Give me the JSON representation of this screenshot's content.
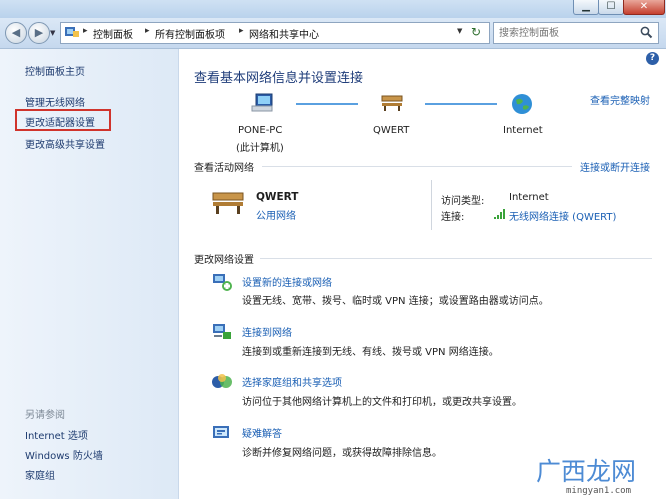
{
  "window": {
    "minimize": "▁",
    "maximize": "☐",
    "close": "✕"
  },
  "nav": {
    "back_glyph": "◀",
    "forward_glyph": "▶",
    "breadcrumbs": [
      "控制面板",
      "所有控制面板项",
      "网络和共享中心"
    ],
    "search_placeholder": "搜索控制面板"
  },
  "sidebar": {
    "home": "控制面板主页",
    "items": [
      "管理无线网络",
      "更改适配器设置",
      "更改高级共享设置"
    ],
    "see_also_title": "另请参阅",
    "see_also": [
      "Internet 选项",
      "Windows 防火墙",
      "家庭组"
    ]
  },
  "main": {
    "title": "查看基本网络信息并设置连接",
    "full_map_link": "查看完整映射",
    "map_nodes": [
      {
        "label": "PONE-PC",
        "sublabel": "(此计算机)"
      },
      {
        "label": "QWERT",
        "sublabel": ""
      },
      {
        "label": "Internet",
        "sublabel": ""
      }
    ],
    "active_header": "查看活动网络",
    "connect_link": "连接或断开连接",
    "network": {
      "name": "QWERT",
      "type": "公用网络",
      "access_label": "访问类型:",
      "access_value": "Internet",
      "connection_label": "连接:",
      "connection_value": "无线网络连接 (QWERT)"
    },
    "change_header": "更改网络设置",
    "tasks": [
      {
        "title": "设置新的连接或网络",
        "desc": "设置无线、宽带、拨号、临时或 VPN 连接；或设置路由器或访问点。",
        "icon": "network-setup-icon"
      },
      {
        "title": "连接到网络",
        "desc": "连接到或重新连接到无线、有线、拨号或 VPN 网络连接。",
        "icon": "connect-network-icon"
      },
      {
        "title": "选择家庭组和共享选项",
        "desc": "访问位于其他网络计算机上的文件和打印机，或更改共享设置。",
        "icon": "homegroup-icon"
      },
      {
        "title": "疑难解答",
        "desc": "诊断并修复网络问题，或获得故障排除信息。",
        "icon": "troubleshoot-icon"
      }
    ]
  },
  "watermark": {
    "brand": "广西龙网",
    "url": "mingyan1.com"
  },
  "colors": {
    "accent": "#1a5fb4",
    "highlight_box": "#d0342c",
    "sidebar_bg": "#e4eef9"
  }
}
